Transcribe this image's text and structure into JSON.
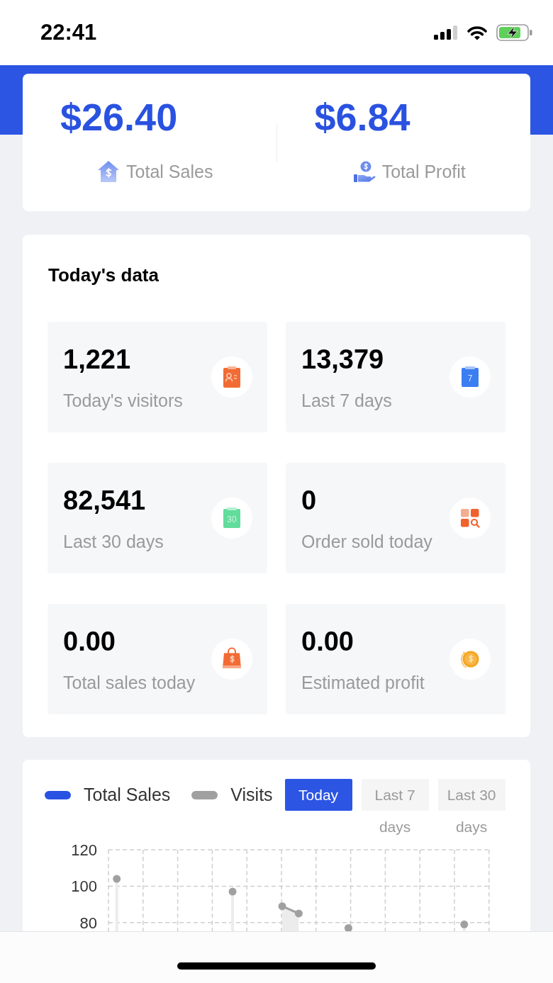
{
  "status_bar": {
    "time": "22:41"
  },
  "summary": [
    {
      "value": "$26.40",
      "label": "Total Sales"
    },
    {
      "value": "$6.84",
      "label": "Total Profit"
    }
  ],
  "todays_data": {
    "title": "Today's data",
    "stats": [
      {
        "value": "1,221",
        "label": "Today's visitors"
      },
      {
        "value": "13,379",
        "label": "Last 7 days",
        "icon_text": "7"
      },
      {
        "value": "82,541",
        "label": "Last 30 days",
        "icon_text": "30"
      },
      {
        "value": "0",
        "label": "Order sold today"
      },
      {
        "value": "0.00",
        "label": "Total sales today"
      },
      {
        "value": "0.00",
        "label": "Estimated profit"
      }
    ]
  },
  "chart": {
    "ranges": [
      {
        "label": "Today",
        "selected": true
      },
      {
        "label": "Last 7 days",
        "selected": false
      },
      {
        "label": "Last 30 days",
        "selected": false
      }
    ],
    "chart_data": {
      "type": "area",
      "categories": [
        null,
        null,
        null,
        null,
        null,
        null,
        null,
        null,
        null,
        null,
        null,
        null,
        null,
        null,
        null,
        null,
        null,
        null,
        null,
        null,
        null,
        null,
        null
      ],
      "ylim": [
        0,
        120
      ],
      "yticks": [
        80,
        100,
        120
      ],
      "grid": true,
      "series": [
        {
          "name": "Total Sales",
          "color": "#2952e3",
          "values": [
            null,
            null,
            null,
            null,
            null,
            null,
            null,
            null,
            null,
            null,
            null,
            null,
            null,
            null,
            null,
            null,
            null,
            null,
            null,
            null,
            null,
            null,
            null
          ]
        },
        {
          "name": "Visits",
          "color": "#a0a0a0",
          "values": [
            104,
            null,
            null,
            null,
            null,
            null,
            null,
            97,
            null,
            null,
            89,
            85,
            null,
            null,
            77,
            null,
            null,
            null,
            null,
            null,
            null,
            79,
            null
          ]
        }
      ]
    }
  }
}
